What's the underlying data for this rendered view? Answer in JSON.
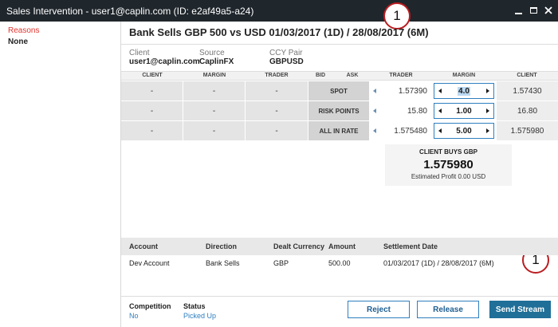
{
  "window": {
    "title": "Sales Intervention - user1@caplin.com (ID: e2af49a5-a24)"
  },
  "callouts": [
    "1",
    "1"
  ],
  "sidebar": {
    "heading": "Reasons",
    "value": "None"
  },
  "header": {
    "title": "Bank Sells GBP 500 vs USD 01/03/2017 (1D) / 28/08/2017 (6M)"
  },
  "meta": {
    "client_label": "Client",
    "client_value": "user1@caplin.com",
    "source_label": "Source",
    "source_value": "CaplinFX",
    "ccy_label": "CCY Pair",
    "ccy_value": "GBPUSD"
  },
  "grid": {
    "headers": {
      "client_left": "CLIENT",
      "margin_left": "MARGIN",
      "trader_left": "TRADER",
      "bid": "BID",
      "ask": "ASK",
      "trader_right": "TRADER",
      "margin_right": "MARGIN",
      "client_right": "CLIENT"
    },
    "rows": [
      {
        "left_client": "-",
        "left_margin": "-",
        "left_trader": "-",
        "label": "SPOT",
        "trader": "1.57390",
        "margin": "4.0",
        "client": "1.57430"
      },
      {
        "left_client": "-",
        "left_margin": "-",
        "left_trader": "-",
        "label": "RISK POINTS",
        "trader": "15.80",
        "margin": "1.00",
        "client": "16.80"
      },
      {
        "left_client": "-",
        "left_margin": "-",
        "left_trader": "-",
        "label": "ALL IN RATE",
        "trader": "1.575480",
        "margin": "5.00",
        "client": "1.575980"
      }
    ]
  },
  "summary": {
    "title": "CLIENT BUYS GBP",
    "rate": "1.575980",
    "profit": "Estimated Profit 0.00 USD"
  },
  "deal": {
    "headers": {
      "account": "Account",
      "direction": "Direction",
      "dealt_currency": "Dealt Currency",
      "amount": "Amount",
      "settlement": "Settlement Date"
    },
    "row": {
      "account": "Dev Account",
      "direction": "Bank Sells",
      "dealt_currency": "GBP",
      "amount": "500.00",
      "settlement": "01/03/2017 (1D) / 28/08/2017 (6M)"
    }
  },
  "footer": {
    "competition_label": "Competition",
    "competition_value": "No",
    "status_label": "Status",
    "status_value": "Picked Up",
    "reject_label": "Reject",
    "release_label": "Release",
    "send_label": "Send Stream"
  },
  "colors": {
    "titlebar": "#1f262c",
    "accent": "#2f7fbf",
    "primary_button": "#1f6f98",
    "reasons_heading": "#e2342e",
    "callout_ring": "#b91d21"
  }
}
